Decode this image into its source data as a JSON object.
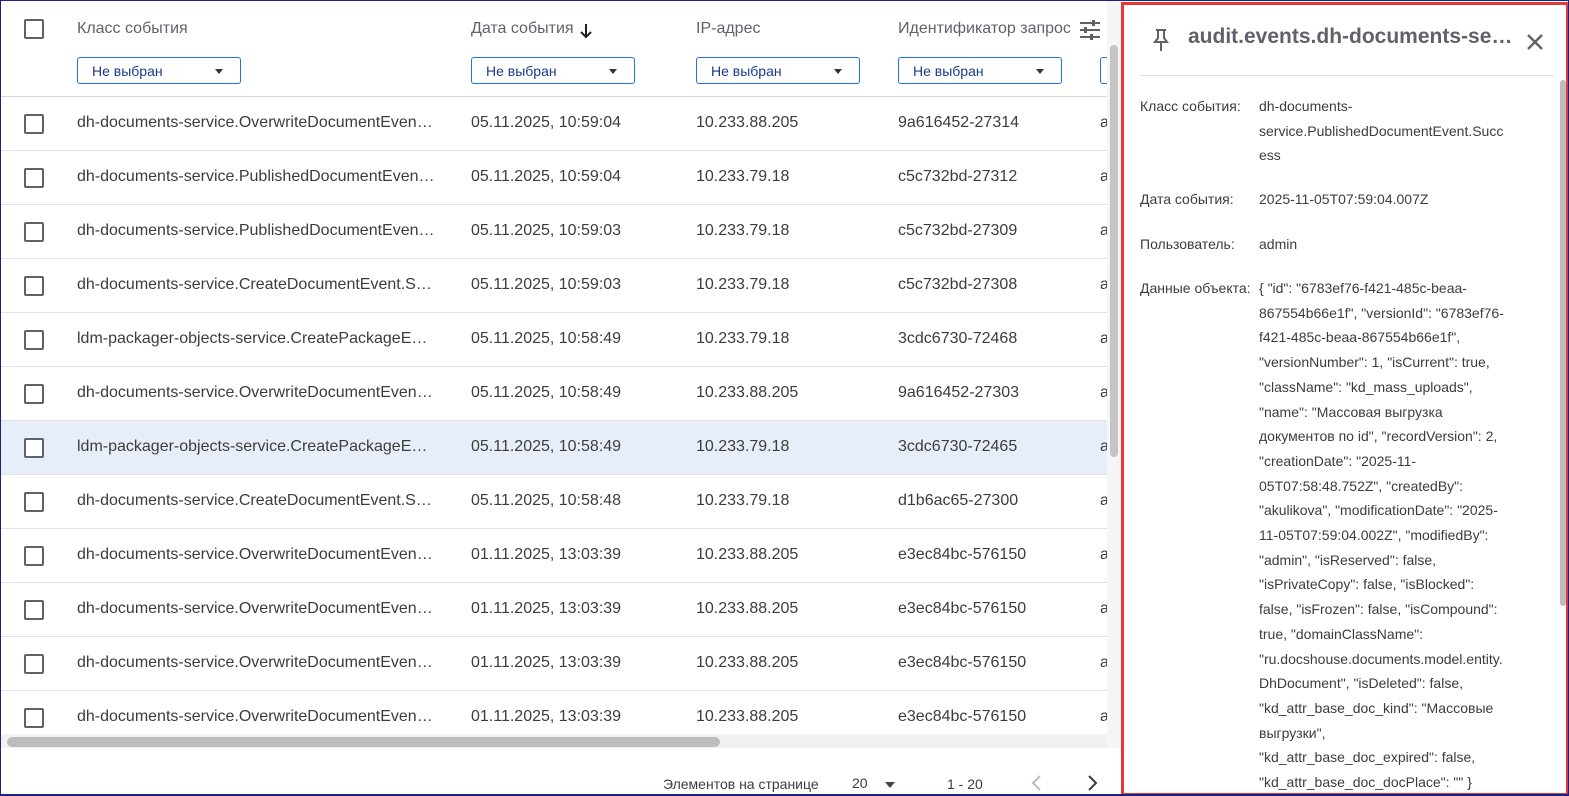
{
  "table": {
    "columns": [
      {
        "label": "Класс события",
        "filter": "Не выбран"
      },
      {
        "label": "Дата события",
        "filter": "Не выбран",
        "sort": "desc"
      },
      {
        "label": "IP-адрес",
        "filter": "Не выбран"
      },
      {
        "label": "Идентификатор запроса",
        "filter": "Не выбран"
      }
    ],
    "rows": [
      {
        "event_class": "dh-documents-service.OverwriteDocumentEvent.Success",
        "date": "05.11.2025, 10:59:04",
        "ip": "10.233.88.205",
        "request_id": "9a616452-27314",
        "extra": "a",
        "highlighted": false
      },
      {
        "event_class": "dh-documents-service.PublishedDocumentEvent.Success",
        "date": "05.11.2025, 10:59:04",
        "ip": "10.233.79.18",
        "request_id": "c5c732bd-27312",
        "extra": "a",
        "highlighted": false
      },
      {
        "event_class": "dh-documents-service.PublishedDocumentEvent.Success",
        "date": "05.11.2025, 10:59:03",
        "ip": "10.233.79.18",
        "request_id": "c5c732bd-27309",
        "extra": "a",
        "highlighted": false
      },
      {
        "event_class": "dh-documents-service.CreateDocumentEvent.Success",
        "date": "05.11.2025, 10:59:03",
        "ip": "10.233.79.18",
        "request_id": "c5c732bd-27308",
        "extra": "a",
        "highlighted": false
      },
      {
        "event_class": "ldm-packager-objects-service.CreatePackageEvent.Success",
        "date": "05.11.2025, 10:58:49",
        "ip": "10.233.79.18",
        "request_id": "3cdc6730-72468",
        "extra": "a",
        "highlighted": false
      },
      {
        "event_class": "dh-documents-service.OverwriteDocumentEvent.Success",
        "date": "05.11.2025, 10:58:49",
        "ip": "10.233.88.205",
        "request_id": "9a616452-27303",
        "extra": "a",
        "highlighted": false
      },
      {
        "event_class": "ldm-packager-objects-service.CreatePackageEvent.Success",
        "date": "05.11.2025, 10:58:49",
        "ip": "10.233.79.18",
        "request_id": "3cdc6730-72465",
        "extra": "a",
        "highlighted": true
      },
      {
        "event_class": "dh-documents-service.CreateDocumentEvent.Success",
        "date": "05.11.2025, 10:58:48",
        "ip": "10.233.79.18",
        "request_id": "d1b6ac65-27300",
        "extra": "a",
        "highlighted": false
      },
      {
        "event_class": "dh-documents-service.OverwriteDocumentEvent.Success",
        "date": "01.11.2025, 13:03:39",
        "ip": "10.233.88.205",
        "request_id": "e3ec84bc-576150",
        "extra": "a",
        "highlighted": false
      },
      {
        "event_class": "dh-documents-service.OverwriteDocumentEvent.Success",
        "date": "01.11.2025, 13:03:39",
        "ip": "10.233.88.205",
        "request_id": "e3ec84bc-576150",
        "extra": "a",
        "highlighted": false
      },
      {
        "event_class": "dh-documents-service.OverwriteDocumentEvent.Success",
        "date": "01.11.2025, 13:03:39",
        "ip": "10.233.88.205",
        "request_id": "e3ec84bc-576150",
        "extra": "a",
        "highlighted": false
      },
      {
        "event_class": "dh-documents-service.OverwriteDocumentEvent.Success",
        "date": "01.11.2025, 13:03:39",
        "ip": "10.233.88.205",
        "request_id": "e3ec84bc-576150",
        "extra": "a",
        "highlighted": false
      }
    ]
  },
  "paginator": {
    "items_per_page_label": "Элементов на странице",
    "page_size": "20",
    "range": "1 - 20"
  },
  "panel": {
    "title": "audit.events.dh-documents-service",
    "props": [
      {
        "label": "Класс события:",
        "value": "dh-documents-service.PublishedDocumentEvent.Success"
      },
      {
        "label": "Дата события:",
        "value": "2025-11-05T07:59:04.007Z"
      },
      {
        "label": "Пользователь:",
        "value": "admin"
      },
      {
        "label": "Данные объекта:",
        "value": "{ \"id\": \"6783ef76-f421-485c-beaa-867554b66e1f\", \"versionId\": \"6783ef76-f421-485c-beaa-867554b66e1f\", \"versionNumber\": 1, \"isCurrent\": true, \"className\": \"kd_mass_uploads\", \"name\": \"Массовая выгрузка документов по id\", \"recordVersion\": 2, \"creationDate\": \"2025-11-05T07:58:48.752Z\", \"createdBy\": \"akulikova\", \"modificationDate\": \"2025-11-05T07:59:04.002Z\", \"modifiedBy\": \"admin\", \"isReserved\": false, \"isPrivateCopy\": false, \"isBlocked\": false, \"isFrozen\": false, \"isCompound\": true, \"domainClassName\": \"ru.docshouse.documents.model.entity.DhDocument\", \"isDeleted\": false, \"kd_attr_base_doc_kind\": \"Массовые выгрузки\", \"kd_attr_base_doc_expired\": false, \"kd_attr_base_doc_docPlace\": \"\" }"
      }
    ]
  },
  "colors": {
    "accent": "#1a73e8",
    "row_highlight": "#e8eef9",
    "panel_border": "#e53935"
  }
}
